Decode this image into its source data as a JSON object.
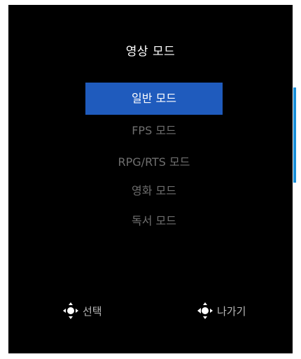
{
  "title": "영상 모드",
  "menu": {
    "items": [
      {
        "label": "일반 모드",
        "selected": true
      },
      {
        "label": "FPS 모드",
        "selected": false
      },
      {
        "label": "RPG/RTS 모드",
        "selected": false
      },
      {
        "label": "영화 모드",
        "selected": false
      },
      {
        "label": "독서 모드",
        "selected": false
      }
    ]
  },
  "hints": {
    "select": {
      "icon": "joystick-press-icon",
      "label": "선택"
    },
    "exit": {
      "icon": "joystick-left-icon",
      "label": "나가기"
    }
  },
  "colors": {
    "background": "#000000",
    "selected_bg": "#1f5bbd",
    "scrollbar": "#1a8fd8",
    "inactive_text": "#6f6f6f"
  }
}
